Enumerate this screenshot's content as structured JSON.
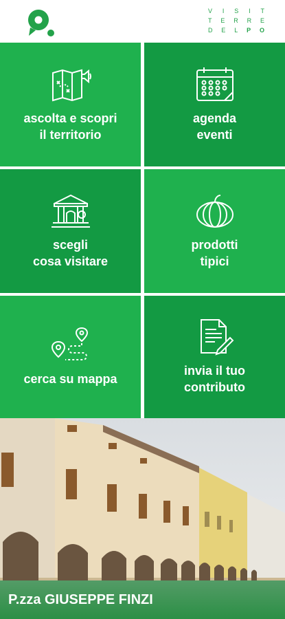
{
  "header": {
    "brand_line1": [
      "V",
      "I",
      "S",
      "I",
      "T"
    ],
    "brand_line2": [
      "T",
      "E",
      "R",
      "R",
      "E"
    ],
    "brand_line3": [
      "D",
      "E",
      "L",
      "P",
      "O"
    ]
  },
  "colors": {
    "primary": "#1fb14e",
    "dark": "#139a43"
  },
  "menu": [
    {
      "icon": "map-audio-icon",
      "line1": "ascolta e scopri",
      "line2": "il territorio"
    },
    {
      "icon": "calendar-icon",
      "line1": "agenda",
      "line2": "eventi"
    },
    {
      "icon": "museum-icon",
      "line1": "scegli",
      "line2": "cosa visitare"
    },
    {
      "icon": "pumpkin-icon",
      "line1": "prodotti",
      "line2": "tipici"
    },
    {
      "icon": "route-pin-icon",
      "line1": "cerca su mappa",
      "line2": ""
    },
    {
      "icon": "document-pen-icon",
      "line1": "invia il tuo",
      "line2": "contributo"
    }
  ],
  "photo": {
    "caption": "P.zza GIUSEPPE FINZI"
  }
}
